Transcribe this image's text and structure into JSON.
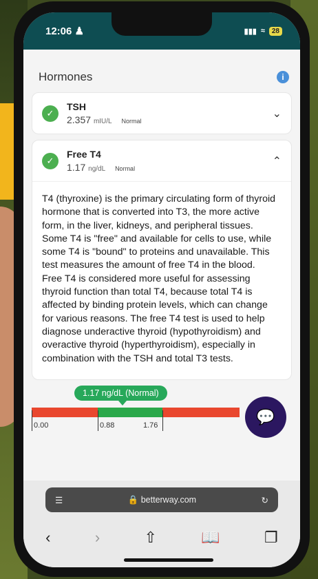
{
  "status": {
    "time": "12:06",
    "battery": "28"
  },
  "section": {
    "title": "Hormones",
    "info_icon": "i"
  },
  "tests": [
    {
      "name": "TSH",
      "value": "2.357",
      "unit": "mIU/L",
      "status": "Normal",
      "expanded": false
    },
    {
      "name": "Free T4",
      "value": "1.17",
      "unit": "ng/dL",
      "status": "Normal",
      "expanded": true
    }
  ],
  "description": "T4 (thyroxine) is the primary circulating form of thyroid hormone that is converted into T3, the more active form, in the liver, kidneys, and peripheral tissues. Some T4 is \"free\" and available for cells to use, while some T4 is \"bound\" to proteins and unavailable. This test measures the amount of free T4 in the blood. Free T4 is considered more useful for assessing thyroid function than total T4, because total T4 is affected by binding protein levels, which can change for various reasons. The free T4 test is used to help diagnose underactive thyroid (hypothyroidism) and overactive thyroid (hyperthyroidism), especially in combination with the TSH and total T3 tests.",
  "range": {
    "badge": "1.17 ng/dL (Normal)",
    "ticks": [
      "0.00",
      "0.88",
      "1.76"
    ],
    "value": 1.17,
    "colors": {
      "low": "#e9472e",
      "normal": "#2aa84a",
      "high": "#e9472e"
    }
  },
  "browser": {
    "url": "betterway.com"
  },
  "icons": {
    "check": "check-icon",
    "chevron_down": "chevron-down-icon",
    "chevron_up": "chevron-up-icon",
    "chat": "chat-icon",
    "tabs": "tabs-icon",
    "reload": "reload-icon",
    "lock": "lock-icon",
    "back": "back-icon",
    "forward": "forward-icon",
    "share": "share-icon",
    "bookmarks": "bookmarks-icon",
    "pages": "pages-icon"
  }
}
